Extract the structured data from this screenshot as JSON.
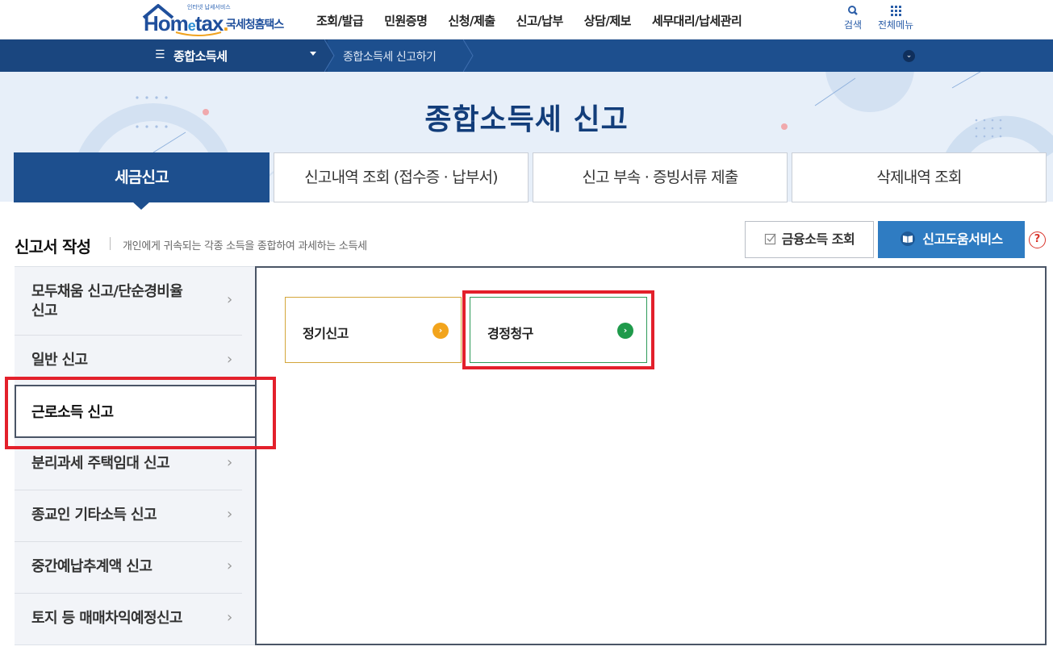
{
  "header": {
    "logo_small": "인터넷 납세서비스",
    "logo_main_1": "Hom",
    "logo_main_e": "e",
    "logo_main_2": "tax",
    "logo_dot": ".",
    "logo_korean": "국세청홈택스",
    "nav": [
      "조회/발급",
      "민원증명",
      "신청/제출",
      "신고/납부",
      "상담/제보",
      "세무대리/납세관리"
    ],
    "search_label": "검색",
    "menu_label": "전체메뉴"
  },
  "navbar": {
    "select_label": "종합소득세",
    "breadcrumb": "종합소득세 신고하기"
  },
  "hero": {
    "title": "종합소득세 신고"
  },
  "tabs": [
    {
      "label": "세금신고",
      "active": true
    },
    {
      "label": "신고내역 조회 (접수증 · 납부서)",
      "active": false
    },
    {
      "label": "신고 부속 · 증빙서류 제출",
      "active": false
    },
    {
      "label": "삭제내역 조회",
      "active": false
    }
  ],
  "section": {
    "title": "신고서 작성",
    "description": "개인에게 귀속되는 각종 소득을 종합하여 과세하는 소득세",
    "fin_button": "금융소득 조회",
    "help_button": "신고도움서비스",
    "help_q": "?"
  },
  "side_menu": [
    {
      "label_1": "모두채움 신고/단순경비율",
      "label_2": "신고",
      "active": false
    },
    {
      "label_1": "일반 신고",
      "label_2": "",
      "active": false
    },
    {
      "label_1": "근로소득 신고",
      "label_2": "",
      "active": true
    },
    {
      "label_1": "분리과세 주택임대 신고",
      "label_2": "",
      "active": false
    },
    {
      "label_1": "종교인 기타소득 신고",
      "label_2": "",
      "active": false
    },
    {
      "label_1": "중간예납추계액 신고",
      "label_2": "",
      "active": false
    },
    {
      "label_1": "토지 등 매매차익예정신고",
      "label_2": "",
      "active": false
    }
  ],
  "cards": {
    "regular": "정기신고",
    "correction": "경정청구"
  },
  "colors": {
    "primary": "#1d4f8e",
    "help_button": "#2f7cc2",
    "highlight": "#e3202b",
    "regular_accent": "#f2a41c",
    "correction_accent": "#1f9a4b"
  }
}
